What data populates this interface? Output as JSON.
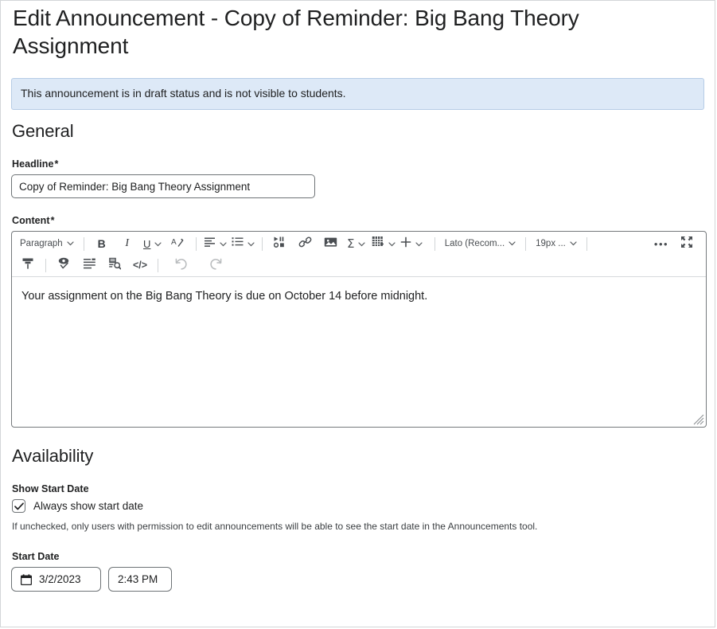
{
  "page": {
    "title": "Edit Announcement - Copy of Reminder: Big Bang Theory Assignment",
    "status_banner": "This announcement is in draft status and is not visible to students."
  },
  "colors": {
    "banner_bg": "#dde9f7",
    "banner_border": "#b6cce6",
    "text": "#202122",
    "input_border": "#6e7376",
    "toolbar_icon": "#4a4e52",
    "disabled_icon": "#b9bcbe"
  },
  "general": {
    "heading": "General",
    "headline": {
      "label": "Headline",
      "required_mark": "*",
      "value": "Copy of Reminder: Big Bang Theory Assignment",
      "placeholder": ""
    },
    "content": {
      "label": "Content",
      "required_mark": "*",
      "body_text": "Your assignment on the Big Bang Theory is due on October 14 before midnight.",
      "toolbar_row1": [
        {
          "name": "paragraph-format-select",
          "label": "Paragraph",
          "has_chevron": true,
          "type": "select"
        },
        {
          "name": "bold-button",
          "label": "B",
          "icon": "bold-icon",
          "type": "icon"
        },
        {
          "name": "italic-button",
          "label": "I",
          "icon": "italic-icon",
          "type": "icon"
        },
        {
          "name": "underline-button",
          "icon": "underline-icon",
          "has_chevron": true,
          "type": "icon"
        },
        {
          "name": "text-color-button",
          "icon": "text-color-icon",
          "type": "icon"
        },
        {
          "name": "align-button",
          "icon": "align-left-icon",
          "has_chevron": true,
          "type": "icon"
        },
        {
          "name": "list-button",
          "icon": "bullet-list-icon",
          "has_chevron": true,
          "type": "icon"
        },
        {
          "name": "insert-media-button",
          "icon": "media-icon",
          "type": "icon"
        },
        {
          "name": "insert-link-button",
          "icon": "link-icon",
          "type": "icon"
        },
        {
          "name": "insert-image-button",
          "icon": "image-icon",
          "type": "icon"
        },
        {
          "name": "insert-equation-button",
          "icon": "sigma-icon",
          "has_chevron": true,
          "type": "icon"
        },
        {
          "name": "insert-table-button",
          "icon": "table-icon",
          "has_chevron": true,
          "type": "icon"
        },
        {
          "name": "insert-more-button",
          "icon": "plus-icon",
          "has_chevron": true,
          "type": "icon"
        }
      ],
      "font_family_select": {
        "label": "Lato (Recom...",
        "name": "font-family-select"
      },
      "font_size_select": {
        "label": "19px ...",
        "name": "font-size-select"
      },
      "overflow_button": {
        "label": "•••",
        "name": "toolbar-overflow-button"
      },
      "fullscreen_button": {
        "name": "fullscreen-button",
        "icon": "fullscreen-icon"
      },
      "toolbar_row2": [
        {
          "name": "clear-formatting-button",
          "icon": "format-painter-icon",
          "enabled": true
        },
        {
          "name": "accessibility-checker-button",
          "icon": "accessibility-check-icon",
          "enabled": true
        },
        {
          "name": "word-count-button",
          "icon": "word-count-icon",
          "enabled": true
        },
        {
          "name": "preview-button",
          "icon": "preview-find-icon",
          "enabled": true
        },
        {
          "name": "source-code-button",
          "icon": "code-view-icon",
          "label": "</>",
          "enabled": true
        },
        {
          "name": "undo-button",
          "icon": "undo-icon",
          "enabled": false
        },
        {
          "name": "redo-button",
          "icon": "redo-icon",
          "enabled": false
        }
      ]
    }
  },
  "availability": {
    "heading": "Availability",
    "show_start_date": {
      "label": "Show Start Date",
      "checkbox_label": "Always show start date",
      "checked": true,
      "help_text": "If unchecked, only users with permission to edit announcements will be able to see the start date in the Announcements tool."
    },
    "start_date": {
      "label": "Start Date",
      "date_value": "3/2/2023",
      "time_value": "2:43 PM",
      "calendar_icon": "calendar-icon"
    }
  }
}
